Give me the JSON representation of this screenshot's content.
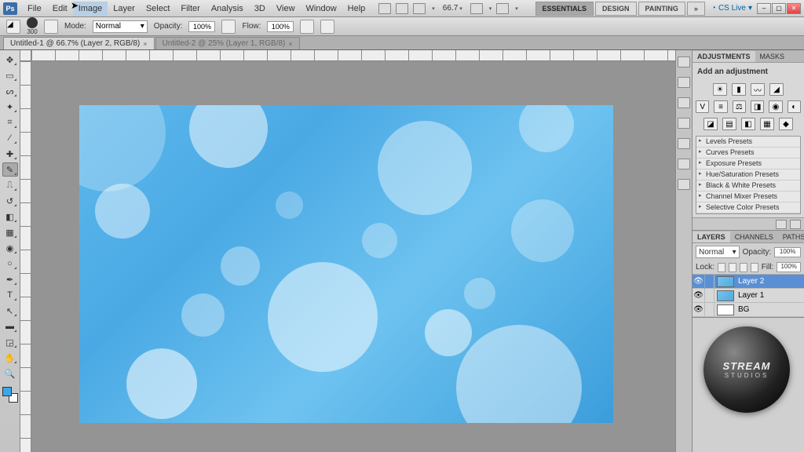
{
  "app": {
    "logo": "Ps"
  },
  "menu": [
    "File",
    "Edit",
    "Image",
    "Layer",
    "Select",
    "Filter",
    "Analysis",
    "3D",
    "View",
    "Window",
    "Help"
  ],
  "menu_hover_index": 2,
  "workspace_tabs": [
    "ESSENTIALS",
    "DESIGN",
    "PAINTING"
  ],
  "workspace_active": 0,
  "cslive": "CS Live",
  "zoom_display": "66.7",
  "options": {
    "brush_size": "300",
    "mode_label": "Mode:",
    "mode_value": "Normal",
    "opacity_label": "Opacity:",
    "opacity_value": "100%",
    "flow_label": "Flow:",
    "flow_value": "100%"
  },
  "doc_tabs": [
    {
      "label": "Untitled-1 @ 66.7% (Layer 2, RGB/8)",
      "active": true
    },
    {
      "label": "Untitled-2 @ 25% (Layer 1, RGB/8)",
      "active": false
    }
  ],
  "adjustments": {
    "tab": "ADJUSTMENTS",
    "tab2": "MASKS",
    "title": "Add an adjustment",
    "presets": [
      "Levels Presets",
      "Curves Presets",
      "Exposure Presets",
      "Hue/Saturation Presets",
      "Black & White Presets",
      "Channel Mixer Presets",
      "Selective Color Presets"
    ]
  },
  "layers_panel": {
    "tabs": [
      "LAYERS",
      "CHANNELS",
      "PATHS"
    ],
    "blend": "Normal",
    "opacity_label": "Opacity:",
    "opacity": "100%",
    "lock_label": "Lock:",
    "fill_label": "Fill:",
    "fill": "100%",
    "layers": [
      {
        "name": "Layer 2",
        "selected": true,
        "visible": true
      },
      {
        "name": "Layer 1",
        "selected": false,
        "visible": true
      },
      {
        "name": "BG",
        "selected": false,
        "visible": true
      }
    ]
  },
  "watermark": {
    "line1": "STREAM",
    "line2": "STUDIOS"
  }
}
